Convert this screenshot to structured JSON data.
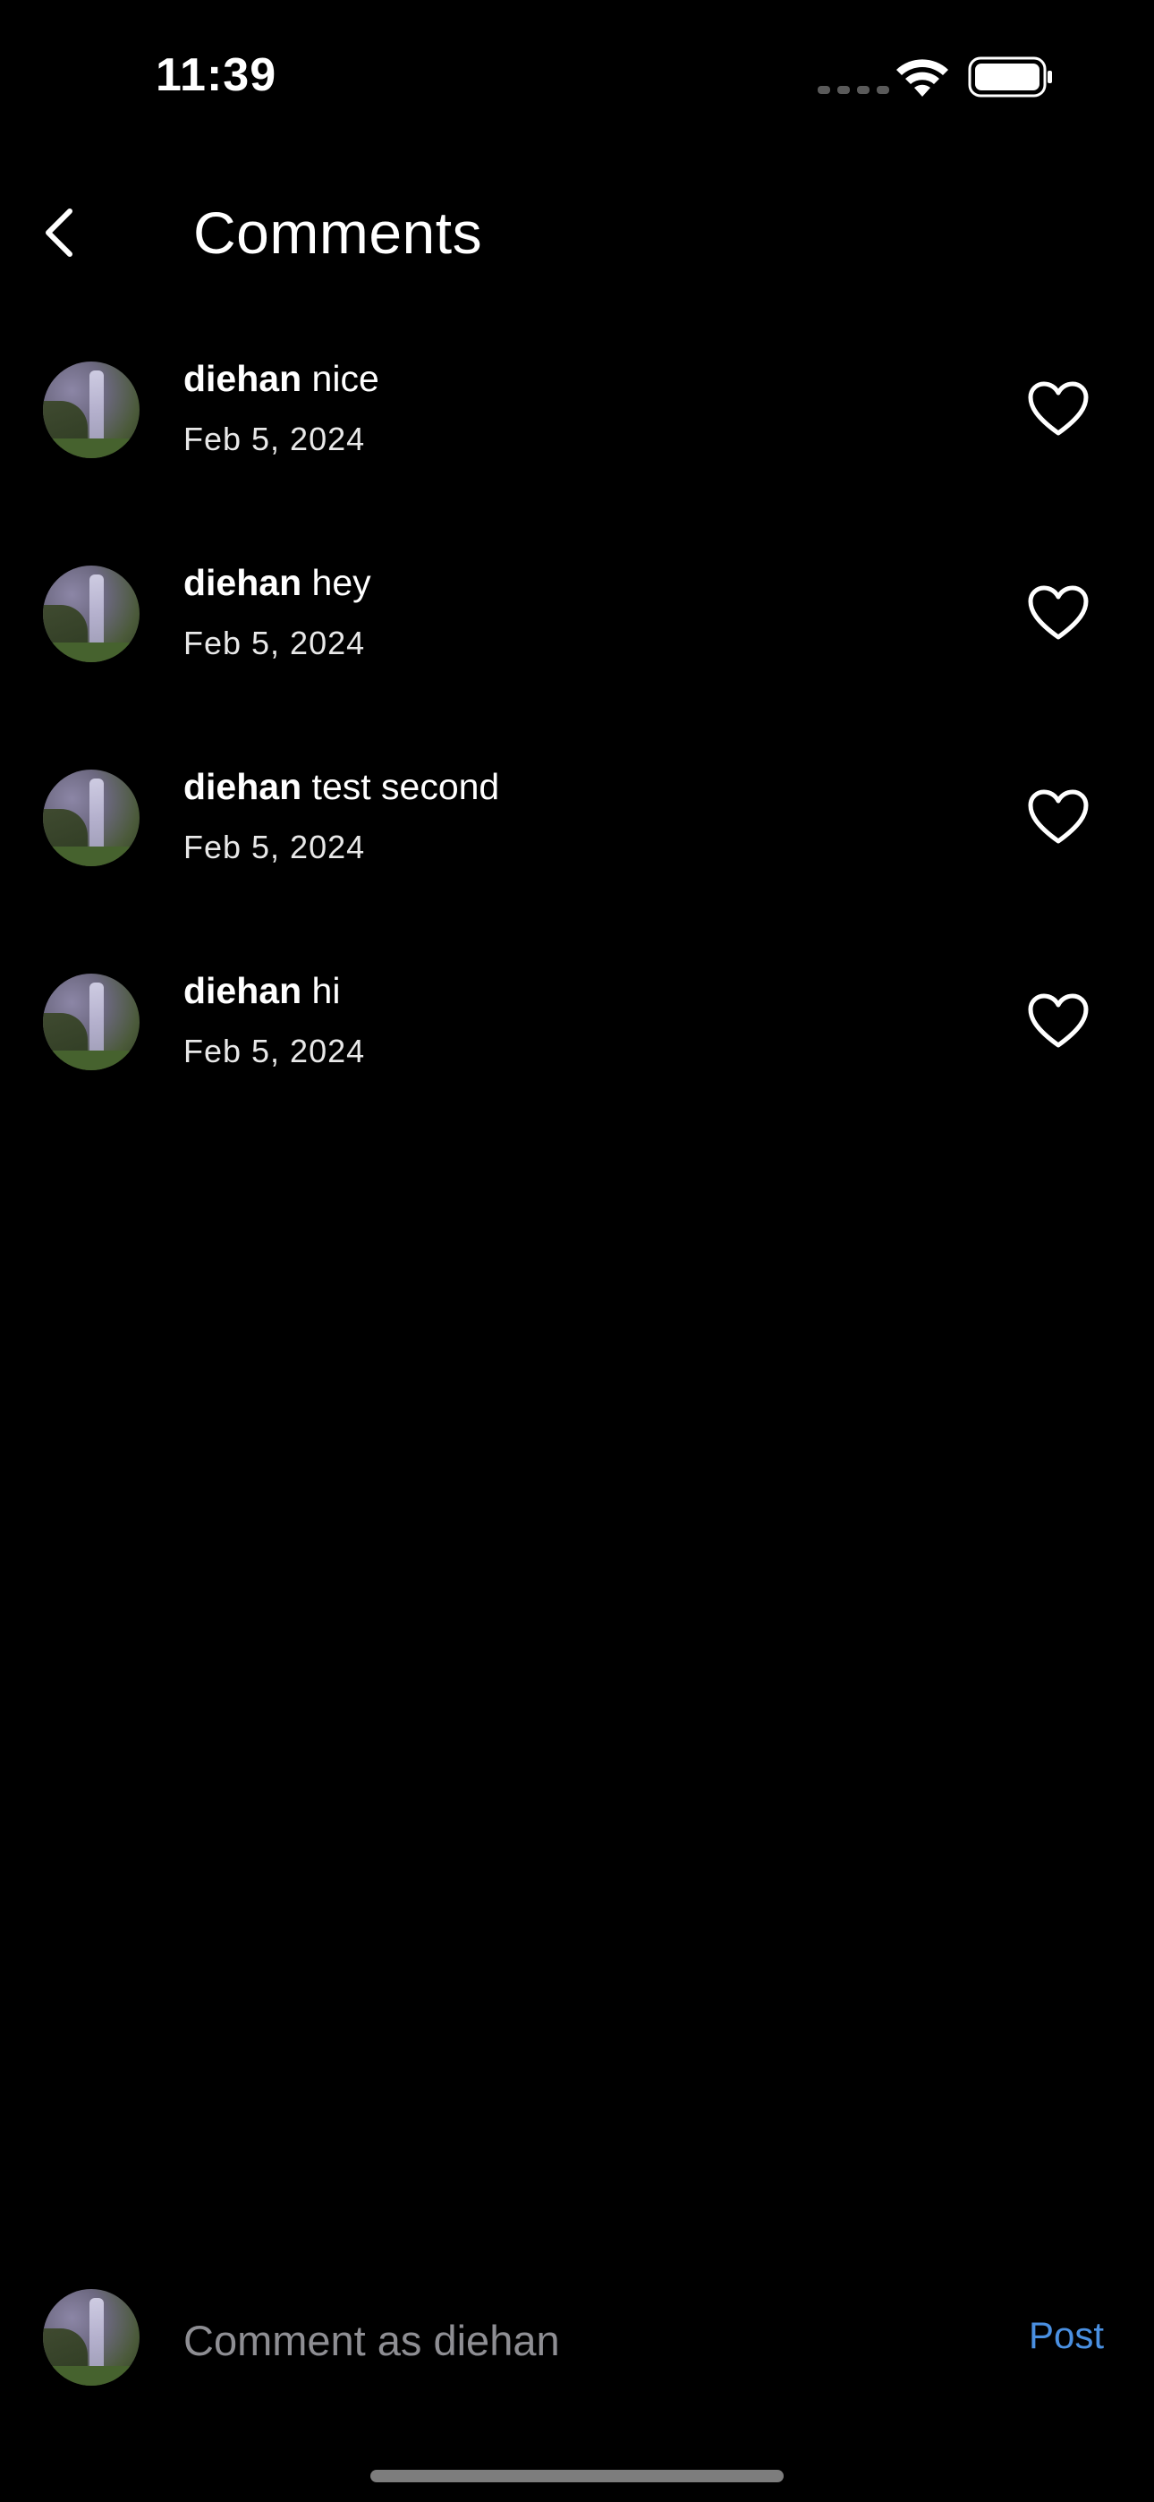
{
  "status_bar": {
    "time": "11:39",
    "signal_icon": "signal-dots-icon",
    "wifi_icon": "wifi-icon",
    "battery_icon": "battery-icon"
  },
  "header": {
    "back_icon": "chevron-left-icon",
    "title": "Comments"
  },
  "comments": [
    {
      "username": "diehan",
      "text": "nice",
      "date": "Feb 5, 2024",
      "like_icon": "heart-outline-icon"
    },
    {
      "username": "diehan",
      "text": "hey",
      "date": "Feb 5, 2024",
      "like_icon": "heart-outline-icon"
    },
    {
      "username": "diehan",
      "text": "test second",
      "date": "Feb 5, 2024",
      "like_icon": "heart-outline-icon"
    },
    {
      "username": "diehan",
      "text": "hi",
      "date": "Feb 5, 2024",
      "like_icon": "heart-outline-icon"
    }
  ],
  "composer": {
    "placeholder": "Comment as diehan",
    "value": "",
    "post_label": "Post"
  },
  "colors": {
    "background": "#000000",
    "text": "#ffffff",
    "accent": "#4a90e2",
    "placeholder": "#8e8e93"
  }
}
